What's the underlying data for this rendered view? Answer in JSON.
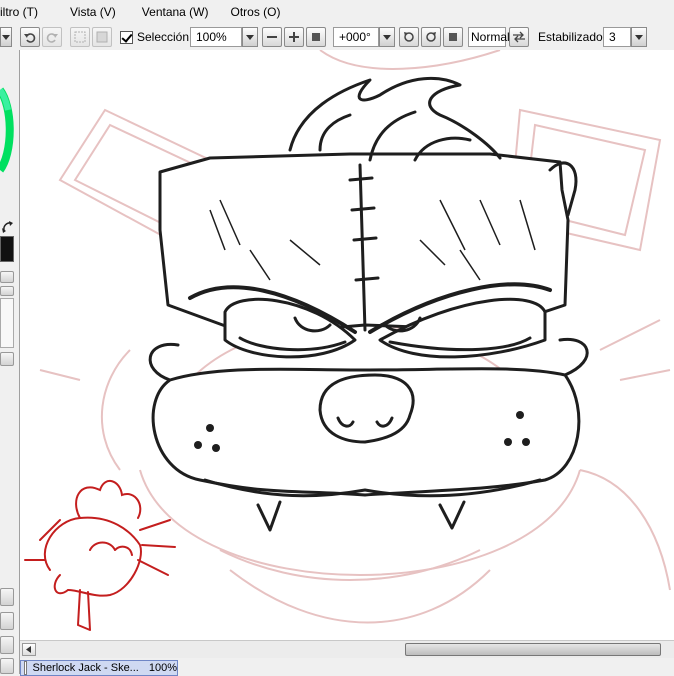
{
  "menu": {
    "items": [
      {
        "label": "iltro (T)"
      },
      {
        "label": "Vista (V)"
      },
      {
        "label": "Ventana (W)"
      },
      {
        "label": "Otros (O)"
      }
    ]
  },
  "toolbar": {
    "selection_label": "Selección",
    "zoom_value": "100%",
    "rotation_value": "+000°",
    "blend_mode": "Normal",
    "stabilizer_label": "Estabilizador",
    "stabilizer_value": "3"
  },
  "document_tab": {
    "title": "Sherlock Jack - Ske...",
    "zoom": "100%"
  },
  "colors": {
    "ink": "#1e1e1e",
    "sketch_pink": "#e7c2c2",
    "sketch_red": "#c41e1e",
    "tab_bg": "#cfd9f2",
    "color_wheel_green": "#00e060"
  }
}
